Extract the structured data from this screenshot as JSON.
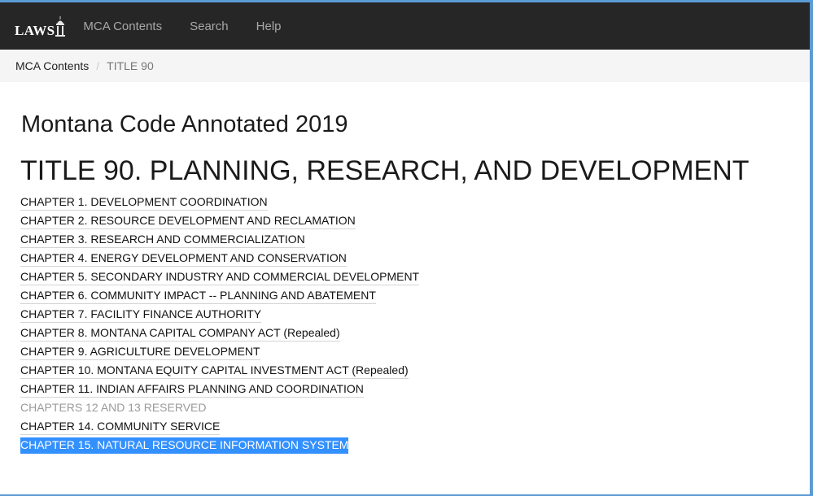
{
  "brand": {
    "logo_text": "LAWS"
  },
  "nav": {
    "items": [
      {
        "label": "MCA Contents"
      },
      {
        "label": "Search"
      },
      {
        "label": "Help"
      }
    ]
  },
  "breadcrumb": {
    "root": "MCA Contents",
    "separator": "/",
    "current": "TITLE 90"
  },
  "main": {
    "page_title": "Montana Code Annotated 2019",
    "title_heading": "TITLE 90. PLANNING, RESEARCH, AND DEVELOPMENT",
    "chapters": [
      {
        "label": "CHAPTER 1. DEVELOPMENT COORDINATION",
        "state": "normal"
      },
      {
        "label": "CHAPTER 2. RESOURCE DEVELOPMENT AND RECLAMATION",
        "state": "normal"
      },
      {
        "label": "CHAPTER 3. RESEARCH AND COMMERCIALIZATION",
        "state": "normal"
      },
      {
        "label": "CHAPTER 4. ENERGY DEVELOPMENT AND CONSERVATION",
        "state": "normal"
      },
      {
        "label": "CHAPTER 5. SECONDARY INDUSTRY AND COMMERCIAL DEVELOPMENT",
        "state": "normal"
      },
      {
        "label": "CHAPTER 6. COMMUNITY IMPACT -- PLANNING AND ABATEMENT",
        "state": "normal"
      },
      {
        "label": "CHAPTER 7. FACILITY FINANCE AUTHORITY",
        "state": "normal"
      },
      {
        "label": "CHAPTER 8. MONTANA CAPITAL COMPANY ACT (Repealed)",
        "state": "normal"
      },
      {
        "label": "CHAPTER 9. AGRICULTURE DEVELOPMENT",
        "state": "normal"
      },
      {
        "label": "CHAPTER 10. MONTANA EQUITY CAPITAL INVESTMENT ACT (Repealed)",
        "state": "normal"
      },
      {
        "label": "CHAPTER 11. INDIAN AFFAIRS PLANNING AND COORDINATION",
        "state": "normal"
      },
      {
        "label": "CHAPTERS 12 AND 13 RESERVED",
        "state": "muted"
      },
      {
        "label": "CHAPTER 14. COMMUNITY SERVICE",
        "state": "normal"
      },
      {
        "label": "CHAPTER 15. NATURAL RESOURCE INFORMATION SYSTEM",
        "state": "selected"
      }
    ]
  },
  "colors": {
    "navbar_bg": "#262626",
    "breadcrumb_bg": "#f5f5f5",
    "selection_bg": "#3390ff",
    "window_border": "#5b9bd5"
  }
}
